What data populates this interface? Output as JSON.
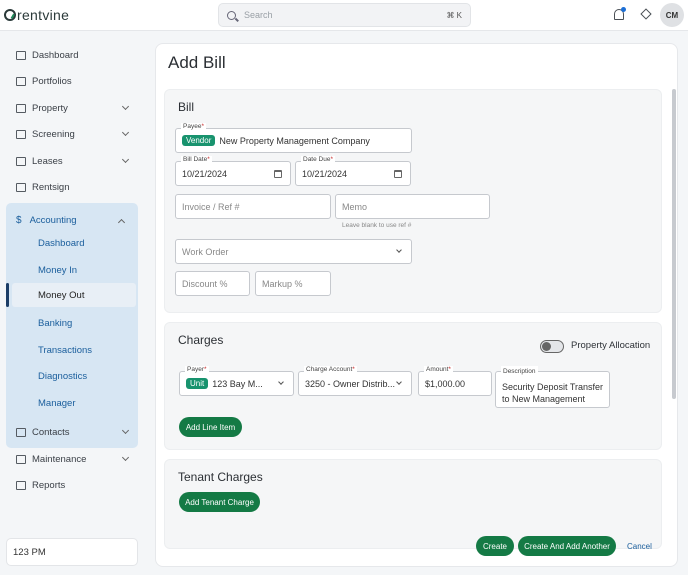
{
  "app": {
    "logo_text": "rentvine"
  },
  "search": {
    "placeholder": "Search",
    "shortcut": "⌘ K"
  },
  "user": {
    "initials": "CM"
  },
  "sidebar": {
    "items": [
      {
        "label": "Dashboard",
        "icon": "dashboard-icon"
      },
      {
        "label": "Portfolios",
        "icon": "portfolio-icon"
      },
      {
        "label": "Property",
        "icon": "building-icon"
      },
      {
        "label": "Screening",
        "icon": "screening-icon"
      },
      {
        "label": "Leases",
        "icon": "lease-icon"
      },
      {
        "label": "Rentsign",
        "icon": "sign-icon"
      }
    ],
    "accounting": {
      "label": "Accounting",
      "sub_items": [
        "Dashboard",
        "Money In",
        "Money Out",
        "Banking",
        "Transactions",
        "Diagnostics",
        "Manager"
      ],
      "active": "Money Out"
    },
    "bottom_items": [
      {
        "label": "Contacts",
        "icon": "contacts-icon"
      },
      {
        "label": "Maintenance",
        "icon": "wrench-icon"
      },
      {
        "label": "Reports",
        "icon": "reports-icon"
      }
    ],
    "footer": "123 PM"
  },
  "page": {
    "title": "Add Bill"
  },
  "bill": {
    "section_title": "Bill",
    "payee_label": "Payee",
    "payee_chip": "Vendor",
    "payee_value": "New Property Management Company",
    "bill_date_label": "Bill Date",
    "bill_date_value": "10/21/2024",
    "date_due_label": "Date Due",
    "date_due_value": "10/21/2024",
    "invoice_placeholder": "Invoice / Ref #",
    "memo_placeholder": "Memo",
    "memo_hint": "Leave blank to use ref #",
    "work_order_placeholder": "Work Order",
    "discount_placeholder": "Discount %",
    "markup_placeholder": "Markup %"
  },
  "charges": {
    "section_title": "Charges",
    "property_allocation_label": "Property Allocation",
    "payer_label": "Payer",
    "payer_chip": "Unit",
    "payer_value": "123 Bay M...",
    "account_label": "Charge Account",
    "account_value": "3250 - Owner Distrib...",
    "amount_label": "Amount",
    "amount_value": "$1,000.00",
    "description_label": "Description",
    "description_value": "Security Deposit Transfer to New Management",
    "add_line_item": "Add Line Item"
  },
  "tenant_charges": {
    "section_title": "Tenant Charges",
    "add_tenant_charge": "Add Tenant Charge"
  },
  "footer": {
    "create": "Create",
    "create_another": "Create And Add Another",
    "cancel": "Cancel"
  },
  "colors": {
    "accent_green": "#147a45",
    "chip_green": "#18936e",
    "accent_blue": "#1a5e9c",
    "nav_group_bg": "#d7e6f3"
  }
}
